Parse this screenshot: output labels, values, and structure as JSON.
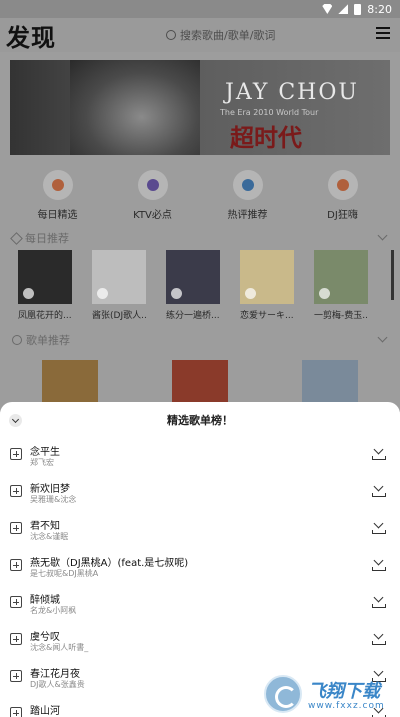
{
  "status_bar": {
    "time": "8:20"
  },
  "header": {
    "title": "发现",
    "search_placeholder": "搜索歌曲/歌单/歌词"
  },
  "banner": {
    "artist": "JAY CHOU",
    "tour": "The Era 2010 World Tour",
    "headline": "超时代"
  },
  "quick_links": [
    {
      "label": "每日精选",
      "icon": "thumbs-up-icon"
    },
    {
      "label": "KTV必点",
      "icon": "ktv-icon"
    },
    {
      "label": "热评推荐",
      "icon": "comment-icon"
    },
    {
      "label": "DJ狂嗨",
      "icon": "dj-icon"
    }
  ],
  "sections": {
    "daily": "每日推荐",
    "playlists": "歌单推荐"
  },
  "daily_albums": [
    {
      "name": "凤凰花开的...",
      "color": "#2a2a2a"
    },
    {
      "name": "酱张(DJ歌人...",
      "color": "#bdbdbd"
    },
    {
      "name": "练分一遍桥...",
      "color": "#3b3b4a"
    },
    {
      "name": "恋爱サーキ...",
      "color": "#c9b98a"
    },
    {
      "name": "一剪梅-费玉...",
      "color": "#7a8a6a"
    }
  ],
  "sheet": {
    "title": "精选歌单榜！",
    "songs": [
      {
        "title": "念平生",
        "artist": "郑飞宏"
      },
      {
        "title": "新欢旧梦",
        "artist": "吴雅珊&沈念"
      },
      {
        "title": "君不知",
        "artist": "沈念&谨眠"
      },
      {
        "title": "燕无歇（DJ黑桃A）(feat.是七叔呢)",
        "artist": "是七叔呢&DJ黑桃A"
      },
      {
        "title": "醉倾城",
        "artist": "名龙&小阿枫"
      },
      {
        "title": "虞兮叹",
        "artist": "沈念&闻人听書_"
      },
      {
        "title": "春江花月夜",
        "artist": "DJ歌人&张鑫贵"
      },
      {
        "title": "踏山河",
        "artist": ""
      }
    ]
  },
  "watermark": {
    "text": "飞翔下载",
    "url": "www.fxxz.com"
  }
}
